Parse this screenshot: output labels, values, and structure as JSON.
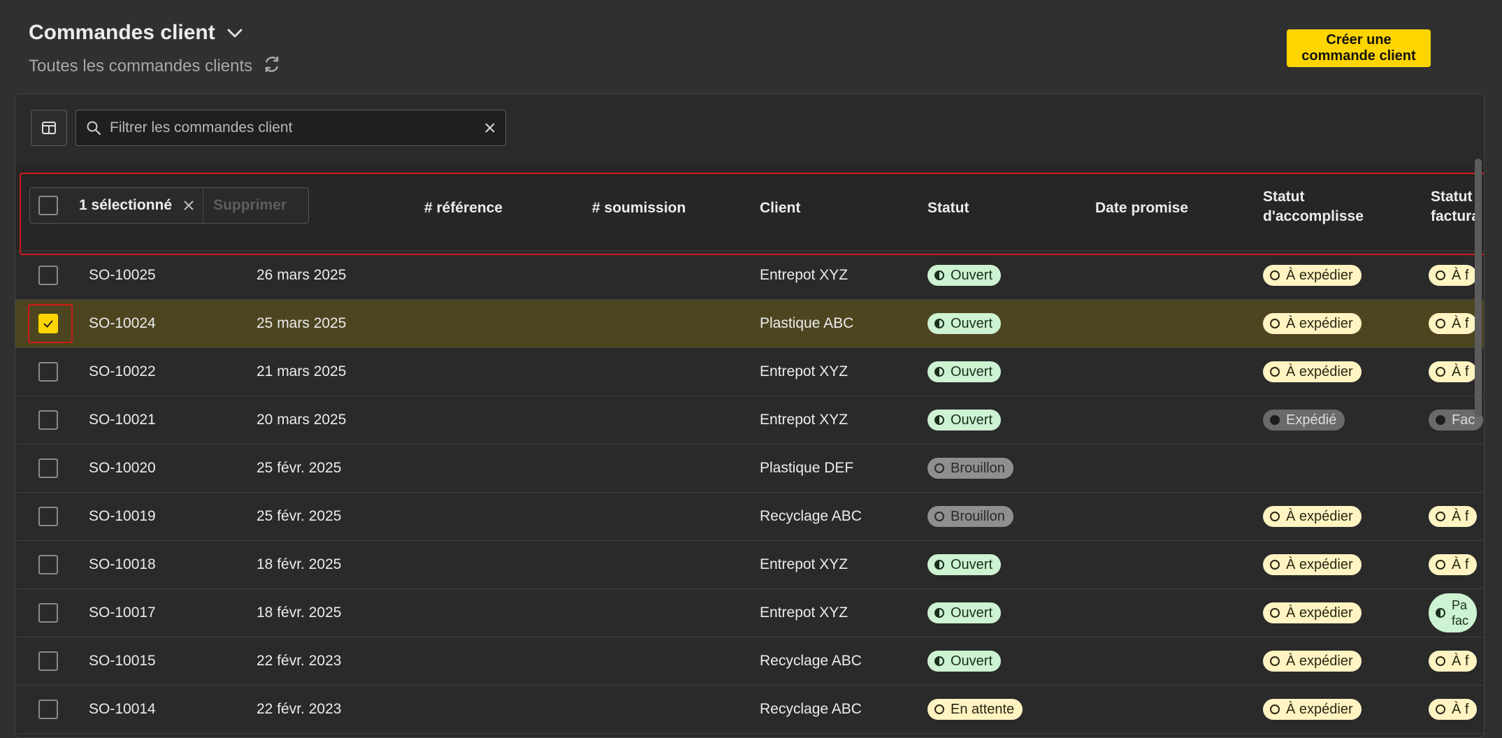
{
  "header": {
    "title": "Commandes client",
    "subtitle": "Toutes les commandes clients",
    "create_button": "Créer une commande client"
  },
  "search": {
    "placeholder": "Filtrer les commandes client"
  },
  "bulk": {
    "selected_label": "1 sélectionné",
    "delete_label": "Supprimer"
  },
  "columns": {
    "reference": "# référence",
    "submission": "# soumission",
    "client": "Client",
    "status": "Statut",
    "promised_date": "Date promise",
    "fulfillment_line1": "Statut",
    "fulfillment_line2": "d'accomplisse",
    "billing_line1": "Statut d",
    "billing_line2": "factura"
  },
  "colors": {
    "accent": "#ffd500",
    "badge_green": "#cdf3d2",
    "badge_yellow": "#fff4c2",
    "badge_gray": "#8f8f8f",
    "selected_row": "#4d4520",
    "highlight_outline": "#d01a1a"
  },
  "rows": [
    {
      "id": "SO-10025",
      "date": "26 mars 2025",
      "client": "Entrepot XYZ",
      "status": "Ouvert",
      "fulfillment": "À expédier",
      "billing": "À f",
      "checked": false
    },
    {
      "id": "SO-10024",
      "date": "25 mars 2025",
      "client": "Plastique ABC",
      "status": "Ouvert",
      "fulfillment": "À expédier",
      "billing": "À f",
      "checked": true
    },
    {
      "id": "SO-10022",
      "date": "21 mars 2025",
      "client": "Entrepot XYZ",
      "status": "Ouvert",
      "fulfillment": "À expédier",
      "billing": "À f",
      "checked": false
    },
    {
      "id": "SO-10021",
      "date": "20 mars 2025",
      "client": "Entrepot XYZ",
      "status": "Ouvert",
      "fulfillment": "Expédié",
      "billing": "Fac",
      "checked": false
    },
    {
      "id": "SO-10020",
      "date": "25 févr. 2025",
      "client": "Plastique DEF",
      "status": "Brouillon",
      "fulfillment": "",
      "billing": "",
      "checked": false
    },
    {
      "id": "SO-10019",
      "date": "25 févr. 2025",
      "client": "Recyclage ABC",
      "status": "Brouillon",
      "fulfillment": "À expédier",
      "billing": "À f",
      "checked": false
    },
    {
      "id": "SO-10018",
      "date": "18 févr. 2025",
      "client": "Entrepot XYZ",
      "status": "Ouvert",
      "fulfillment": "À expédier",
      "billing": "À f",
      "checked": false
    },
    {
      "id": "SO-10017",
      "date": "18 févr. 2025",
      "client": "Entrepot XYZ",
      "status": "Ouvert",
      "fulfillment": "À expédier",
      "billing": "Pa fac",
      "billing_line1": "Pa",
      "billing_line2": "fac",
      "checked": false
    },
    {
      "id": "SO-10015",
      "date": "22 févr. 2023",
      "client": "Recyclage ABC",
      "status": "Ouvert",
      "fulfillment": "À expédier",
      "billing": "À f",
      "checked": false
    },
    {
      "id": "SO-10014",
      "date": "22 févr. 2023",
      "client": "Recyclage ABC",
      "status": "En attente",
      "fulfillment": "À expédier",
      "billing": "À f",
      "checked": false
    }
  ]
}
